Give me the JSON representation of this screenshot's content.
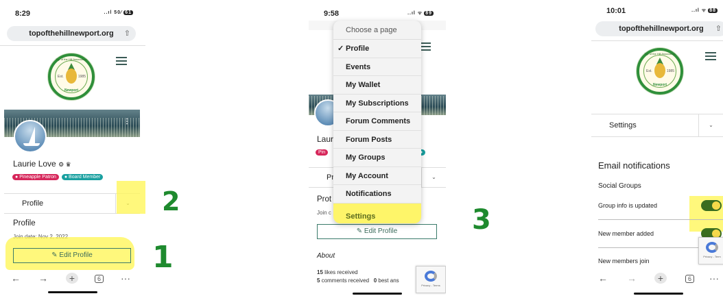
{
  "screen1": {
    "status_time": "8:29",
    "status_icons": "..ıl 50⁄",
    "battery": "61",
    "url": "topofthehillnewport.org",
    "logo_ring_text": "Top of the Hill Association",
    "logo_est": "Est.",
    "logo_year": "1985",
    "logo_bottom": "Newport",
    "profile_name": "Laurie Love",
    "name_icons": "⚙ ♛",
    "badges": [
      {
        "label": "Pineapple Patron",
        "color": "#d6265a"
      },
      {
        "label": "Board Member",
        "color": "#19a0a0"
      }
    ],
    "dropdown_label": "Profile",
    "section_heading": "Profile",
    "join_date": "Join date: Nov 2, 2022",
    "edit_button": "Edit Profile",
    "annotations": [
      "2",
      "1"
    ]
  },
  "screen2": {
    "status_time": "9:58",
    "status_icons": "..ıl ᯤ",
    "battery": "89",
    "menu_header": "Choose a page",
    "menu_items": [
      {
        "label": "Profile",
        "selected": true
      },
      {
        "label": "Events"
      },
      {
        "label": "My Wallet"
      },
      {
        "label": "My Subscriptions"
      },
      {
        "label": "Forum Comments"
      },
      {
        "label": "Forum Posts"
      },
      {
        "label": "My Groups"
      },
      {
        "label": "My Account"
      },
      {
        "label": "Notifications"
      },
      {
        "label": "Settings",
        "highlighted": true
      }
    ],
    "partial_name": "Laur",
    "partial_badge": "Pin",
    "partial_dropdown": "Pr",
    "partial_heading": "Prot",
    "partial_join": "Join c",
    "edit_button": "Edit Profile",
    "about_heading": "About",
    "likes_count": "15",
    "likes_label": "likes received",
    "comments_count": "5",
    "comments_label": "comments received",
    "best_count": "0",
    "best_label": "best ans",
    "recaptcha": "Privacy - Terms",
    "annotation": "3"
  },
  "screen3": {
    "status_time": "10:01",
    "status_icons": "..ıl ᯤ",
    "battery": "88",
    "url": "topofthehillnewport.org",
    "dropdown_label": "Settings",
    "section_heading": "Email notifications",
    "group_heading": "Social Groups",
    "settings": [
      {
        "label": "Group info is updated",
        "on": true
      },
      {
        "label": "New member added",
        "on": true
      },
      {
        "label": "New members join",
        "on": true
      }
    ],
    "recaptcha": "Privacy - Term"
  },
  "colors": {
    "accent": "#3a6d1f",
    "highlight": "#fff550",
    "annotation_green": "#1e8a2e"
  }
}
